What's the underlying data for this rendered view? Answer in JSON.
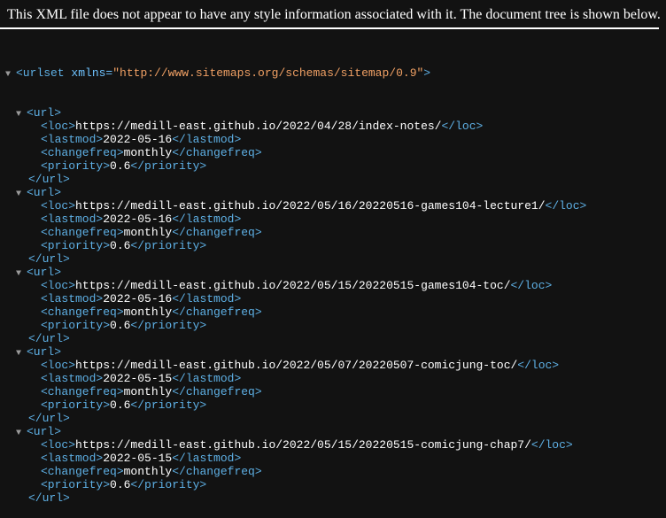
{
  "header": {
    "message": "This XML file does not appear to have any style information associated with it. The document tree is shown below."
  },
  "root": {
    "open_prefix": "<urlset ",
    "attr_name": "xmlns=",
    "attr_value": "\"http://www.sitemaps.org/schemas/sitemap/0.9\"",
    "open_suffix": ">"
  },
  "icons": {
    "expanded": "triangle-down-icon"
  },
  "tags": {
    "url_open": "<url>",
    "url_close": "</url>",
    "loc_open": "<loc>",
    "loc_close": "</loc>",
    "lastmod_open": "<lastmod>",
    "lastmod_close": "</lastmod>",
    "changefreq_open": "<changefreq>",
    "changefreq_close": "</changefreq>",
    "priority_open": "<priority>",
    "priority_close": "</priority>"
  },
  "urls": [
    {
      "loc": "https://medill-east.github.io/2022/04/28/index-notes/",
      "lastmod": "2022-05-16",
      "changefreq": "monthly",
      "priority": "0.6"
    },
    {
      "loc": "https://medill-east.github.io/2022/05/16/20220516-games104-lecture1/",
      "lastmod": "2022-05-16",
      "changefreq": "monthly",
      "priority": "0.6"
    },
    {
      "loc": "https://medill-east.github.io/2022/05/15/20220515-games104-toc/",
      "lastmod": "2022-05-16",
      "changefreq": "monthly",
      "priority": "0.6"
    },
    {
      "loc": "https://medill-east.github.io/2022/05/07/20220507-comicjung-toc/",
      "lastmod": "2022-05-15",
      "changefreq": "monthly",
      "priority": "0.6"
    },
    {
      "loc": "https://medill-east.github.io/2022/05/15/20220515-comicjung-chap7/",
      "lastmod": "2022-05-15",
      "changefreq": "monthly",
      "priority": "0.6"
    }
  ]
}
